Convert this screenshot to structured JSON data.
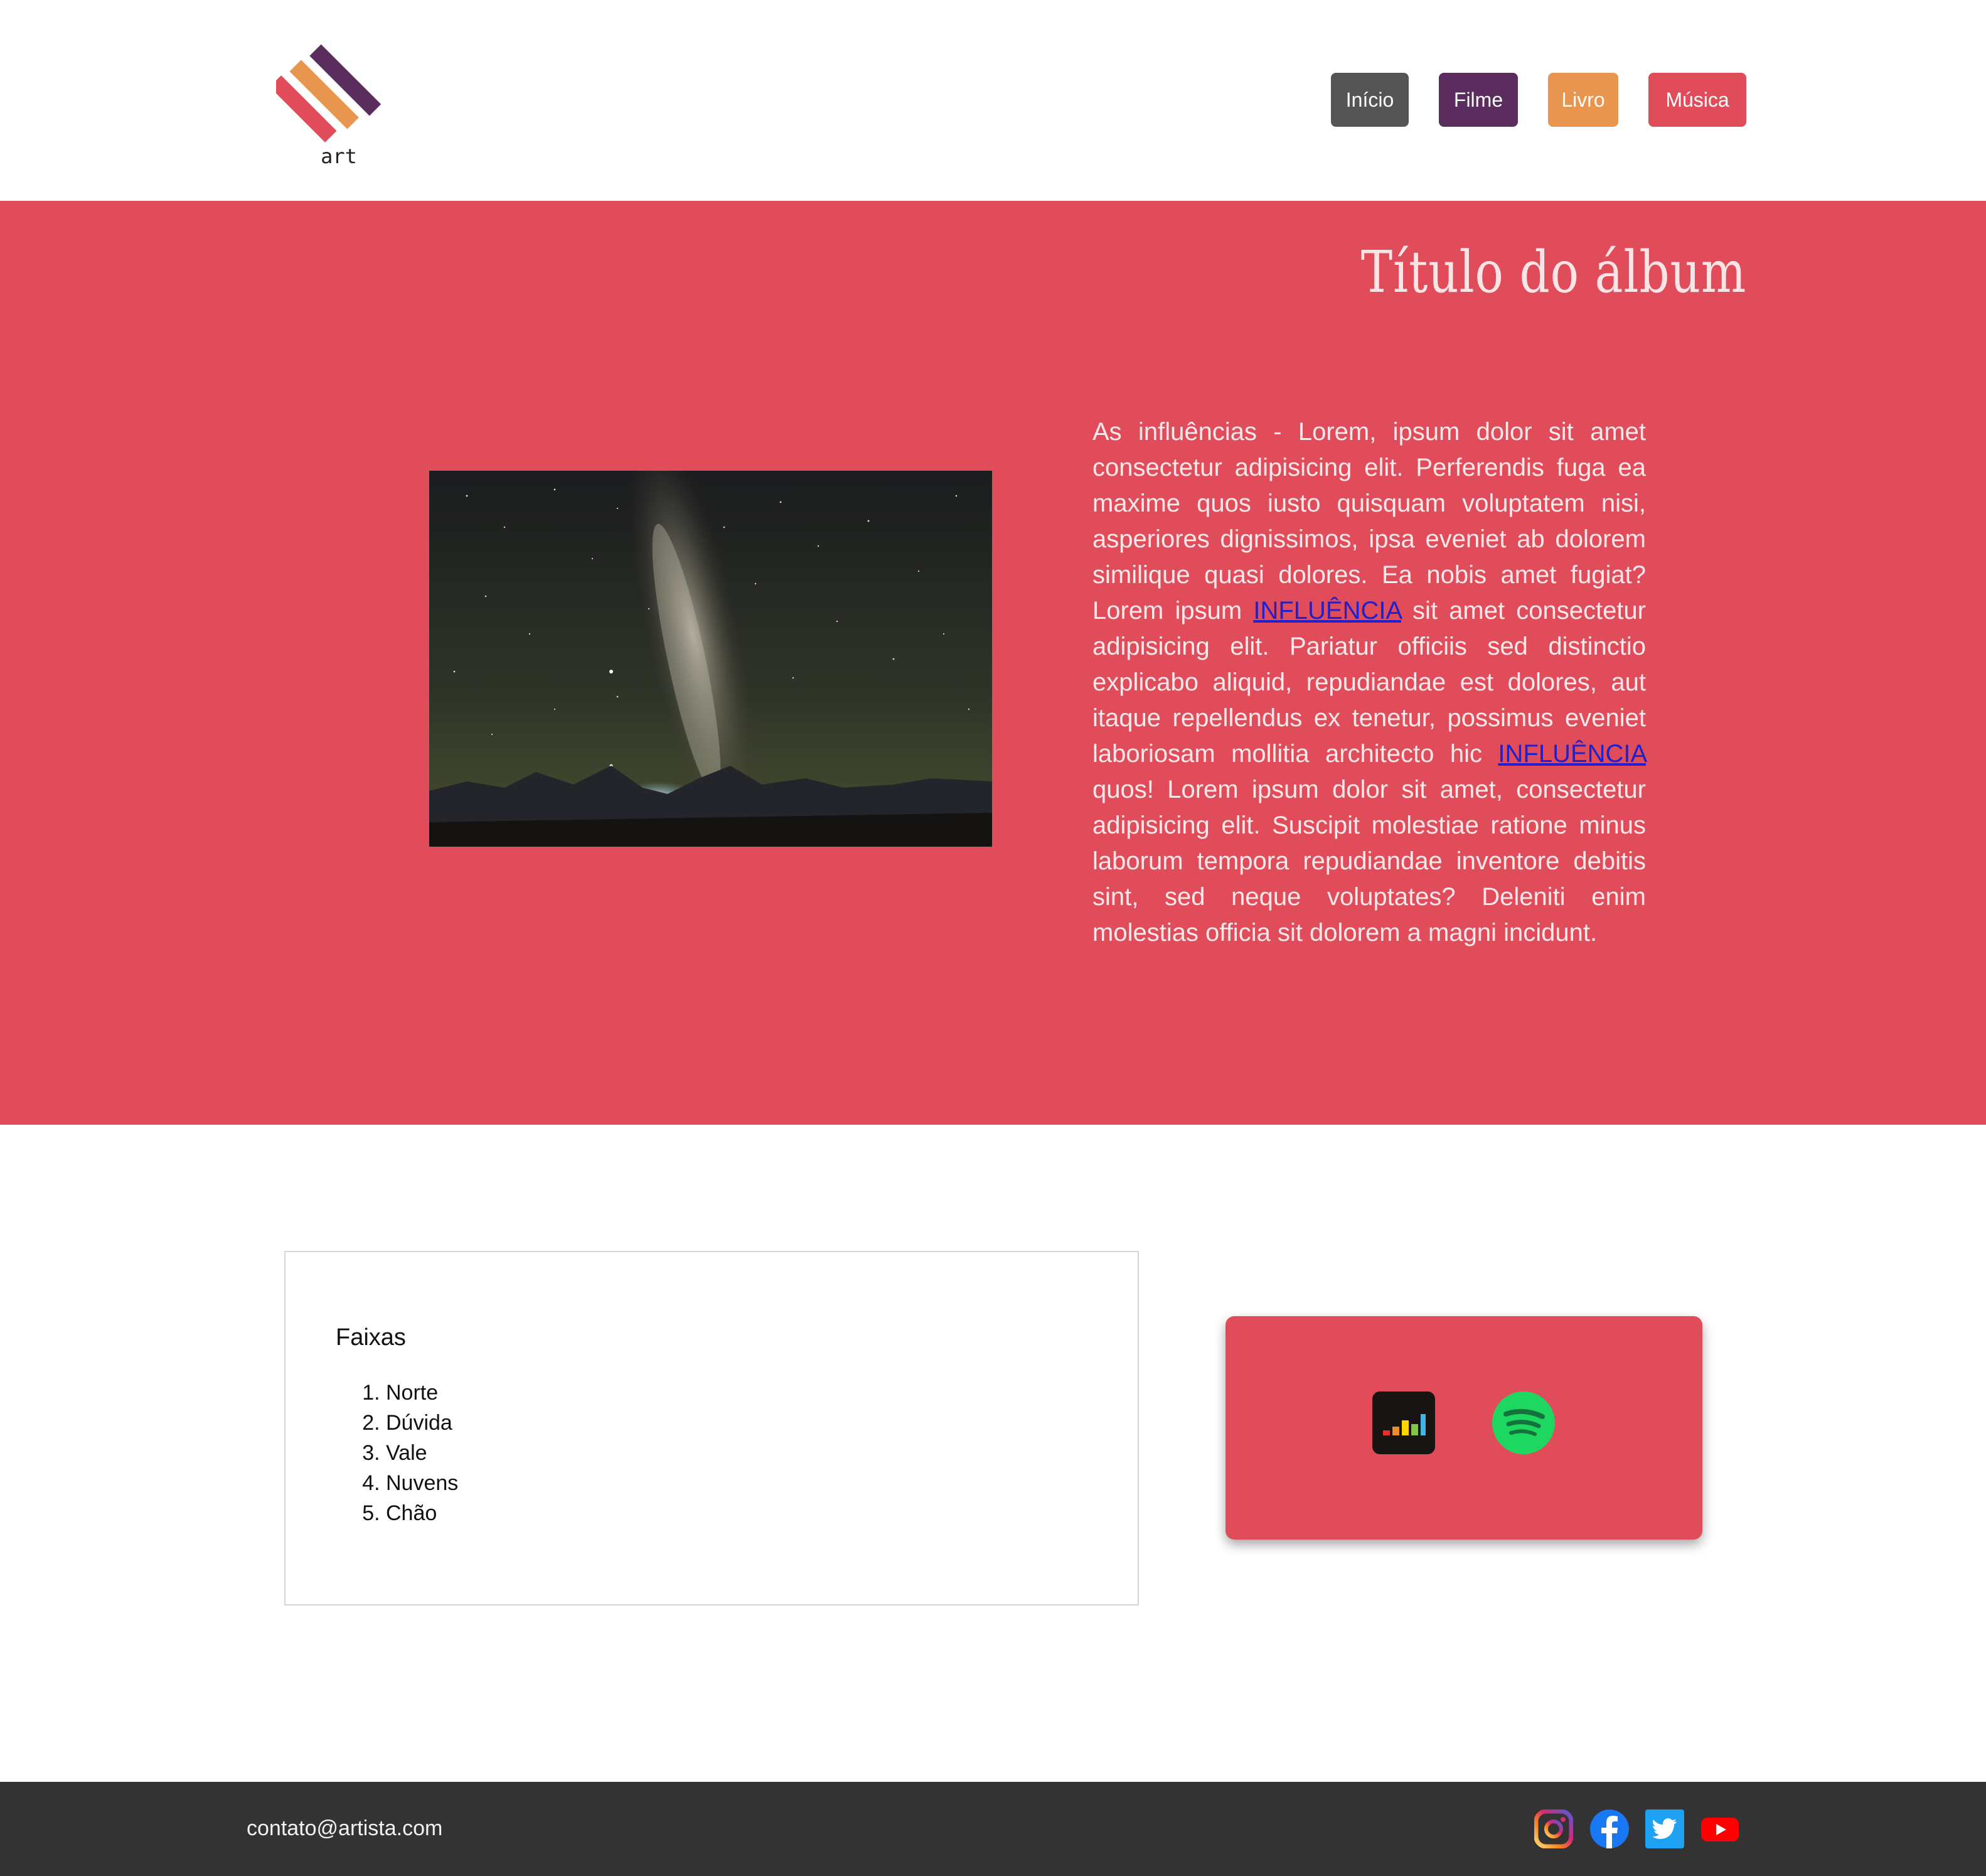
{
  "header": {
    "logo_text": "art",
    "nav": [
      {
        "label": "Início",
        "color": "#555555"
      },
      {
        "label": "Filme",
        "color": "#5a2d5e"
      },
      {
        "label": "Livro",
        "color": "#e8964f"
      },
      {
        "label": "Música",
        "color": "#e04c5a"
      }
    ]
  },
  "hero": {
    "background": "#e04c5a",
    "title": "Título do álbum",
    "description": {
      "part1": "As influências - Lorem, ipsum dolor sit amet consectetur adipisicing elit. Perferendis fuga ea maxime quos iusto quisquam voluptatem nisi, asperiores dignissimos, ipsa eveniet ab dolorem similique quasi dolores. Ea nobis amet fugiat? Lorem ipsum ",
      "link1": "INFLUÊNCIA",
      "part2": " sit amet consectetur adipisicing elit. Pariatur officiis sed distinctio explicabo aliquid, repudiandae est dolores, aut itaque repellendus ex tenetur, possimus eveniet laboriosam mollitia architecto hic ",
      "link2": "INFLUÊNCIA",
      "part3": " quos! Lorem ipsum dolor sit amet, consectetur adipisicing elit. Suscipit molestiae ratione minus laborum tempora repudiandae inventore debitis sint, sed neque voluptates? Deleniti enim molestias officia sit dolorem a magni incidunt."
    }
  },
  "tracks": {
    "title": "Faixas",
    "items": [
      "Norte",
      "Dúvida",
      "Vale",
      "Nuvens",
      "Chão"
    ]
  },
  "streaming": {
    "background": "#e04c5a",
    "services": [
      {
        "icon": "deezer-icon"
      },
      {
        "icon": "spotify-icon"
      }
    ]
  },
  "footer": {
    "background": "#333333",
    "email": "contato@artista.com",
    "social": [
      {
        "icon": "instagram-icon"
      },
      {
        "icon": "facebook-icon"
      },
      {
        "icon": "twitter-icon"
      },
      {
        "icon": "youtube-icon"
      }
    ]
  }
}
